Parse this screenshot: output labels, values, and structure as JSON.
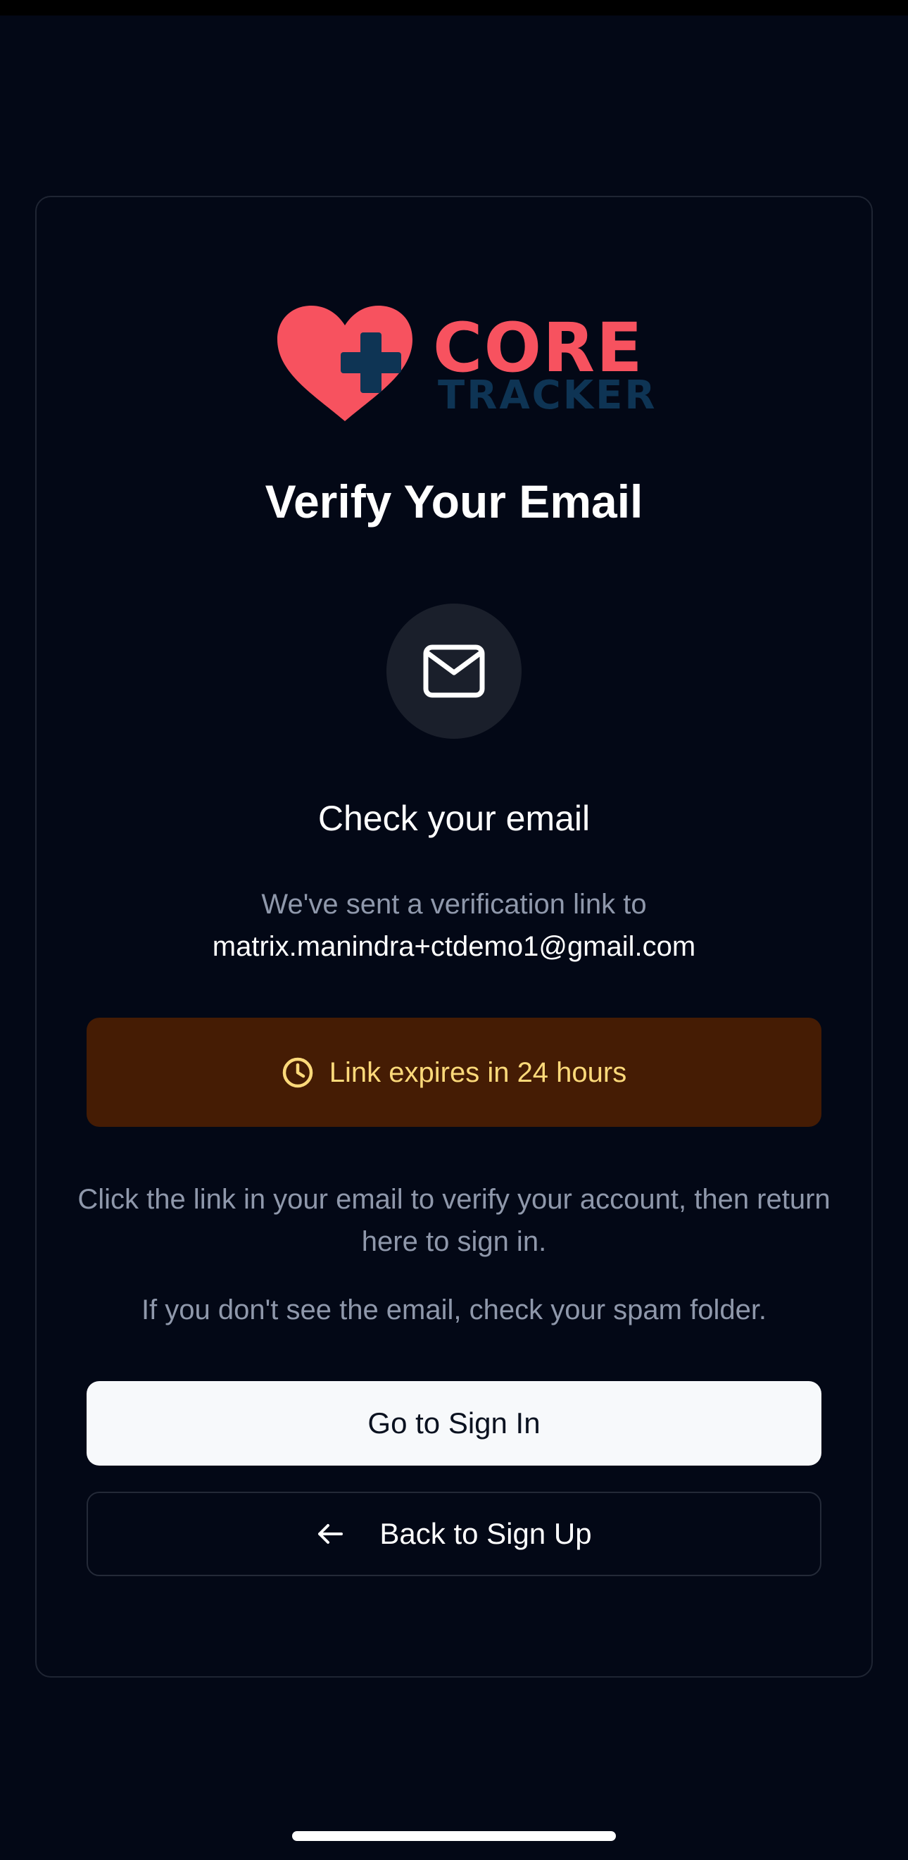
{
  "app": {
    "logo_primary": "CORE",
    "logo_secondary": "TRACKER"
  },
  "page": {
    "title": "Verify Your Email",
    "subtitle": "Check your email",
    "sent_text": "We've sent a verification link to",
    "email": "matrix.manindra+ctdemo1@gmail.com"
  },
  "expiry": {
    "text": "Link expires in 24 hours",
    "icon": "clock-icon"
  },
  "instructions": {
    "line1": "Click the link in your email to verify your account, then return here to sign in.",
    "line2": "If you don't see the email, check your spam folder."
  },
  "buttons": {
    "sign_in": "Go to Sign In",
    "back": "Back to Sign Up",
    "back_icon": "arrow-left-icon"
  },
  "icons": {
    "mail": "mail-icon",
    "logo": "heart-plus-icon"
  },
  "colors": {
    "background": "#030816",
    "brand_red": "#f7525f",
    "brand_navy": "#0e3454",
    "warning_bg": "#451c04",
    "warning_text": "#fcd97a",
    "muted_text": "#8f98ab"
  }
}
